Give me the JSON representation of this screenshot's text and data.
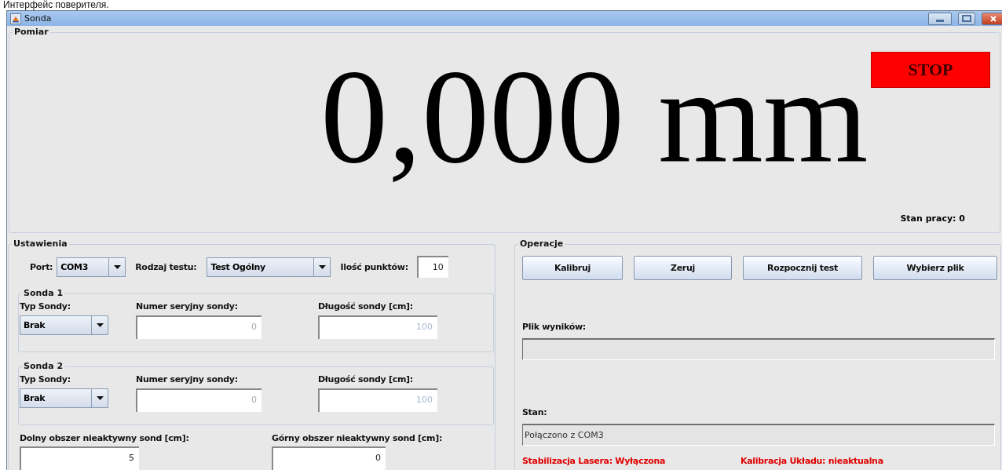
{
  "caption": "Интерфейс поверителя.",
  "window": {
    "title": "Sonda"
  },
  "measurement": {
    "title": "Pomiar",
    "reading": "0,000 mm",
    "stop_button": "STOP",
    "work_state": "Stan pracy: 0"
  },
  "settings": {
    "title": "Ustawienia",
    "port_label": "Port:",
    "port": "COM3",
    "test_type_label": "Rodzaj testu:",
    "test_type": "Test Ogólny",
    "points_label": "Ilość punktów:",
    "points": "10",
    "probes": [
      {
        "title": "Sonda 1",
        "type_label": "Typ Sondy:",
        "type": "Brak",
        "serial_label": "Numer seryjny sondy:",
        "serial": "0",
        "serial_disabled": true,
        "length_label": "Długość sondy [cm]:",
        "length": "100",
        "length_disabled": true
      },
      {
        "title": "Sonda 2",
        "type_label": "Typ Sondy:",
        "type": "Brak",
        "serial_label": "Numer seryjny sondy:",
        "serial": "0",
        "serial_disabled": true,
        "length_label": "Długość sondy [cm]:",
        "length": "100",
        "length_disabled": true
      }
    ],
    "lower_label": "Dolny obszer nieaktywny sond [cm]:",
    "lower": "5",
    "upper_label": "Górny obszer nieaktywny sond [cm]:",
    "upper": "0"
  },
  "operations": {
    "title": "Operacje",
    "buttons": [
      "Kalibruj",
      "Zeruj",
      "Rozpocznij test",
      "Wybierz plik"
    ],
    "results_label": "Plik wyników:",
    "status_label": "Stan:",
    "status": "Połączono z COM3",
    "indicators": [
      "Stabilizacja Lasera: Wyłączona",
      "Kalibracja Układu: nieaktualna"
    ]
  }
}
